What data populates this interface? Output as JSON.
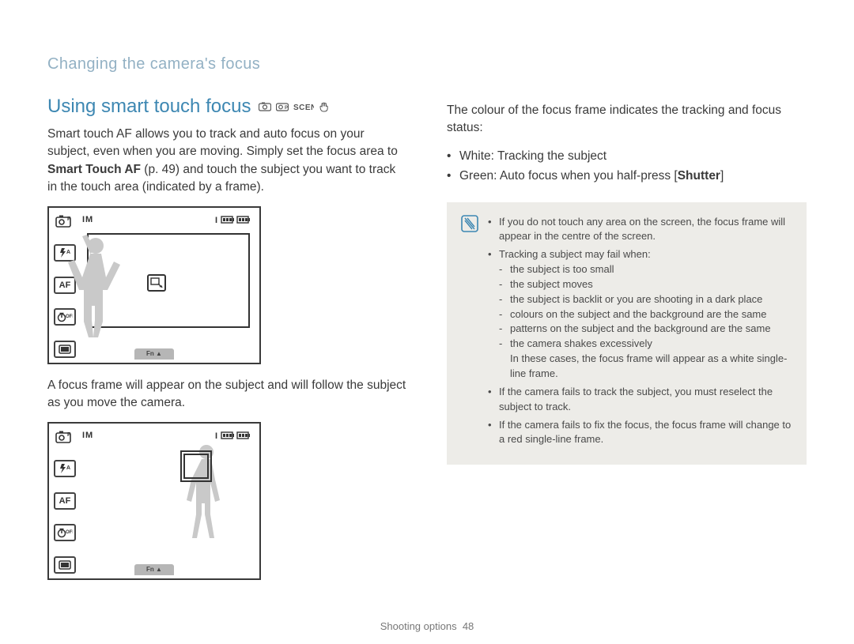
{
  "breadcrumb": "Changing the camera's focus",
  "heading": "Using smart touch focus",
  "left": {
    "p1_a": "Smart touch AF allows you to track and auto focus on your subject, even when you are moving. Simply set the focus area to ",
    "p1_bold": "Smart Touch AF",
    "p1_b": " (p. 49) and touch the subject you want to track in the touch area (indicated by a frame).",
    "p2": "A focus frame will appear on the subject and will follow the subject as you move the camera."
  },
  "right": {
    "intro": "The colour of the focus frame indicates the tracking and focus status:",
    "bullet_white": "White: Tracking the subject",
    "bullet_green_a": "Green: Auto focus when you half-press [",
    "bullet_green_bold": "Shutter",
    "bullet_green_b": "]"
  },
  "note": {
    "n1": "If you do not touch any area on the screen, the focus frame will appear in the centre of the screen.",
    "n2": "Tracking a subject may fail when:",
    "s1": "the subject is too small",
    "s2": "the subject moves",
    "s3": "the subject is backlit or you are shooting in a dark place",
    "s4": "colours on the subject and the background are the same",
    "s5": "patterns on the subject and the background are the same",
    "s6": "the camera shakes excessively",
    "trail": "In these cases, the focus frame will appear as a white single-line frame.",
    "n3": "If the camera fails to track the subject, you must reselect the subject to track.",
    "n4": "If the camera fails to fix the focus, the focus frame will change to a red single-line frame."
  },
  "footer": {
    "section": "Shooting options",
    "page": "48"
  }
}
